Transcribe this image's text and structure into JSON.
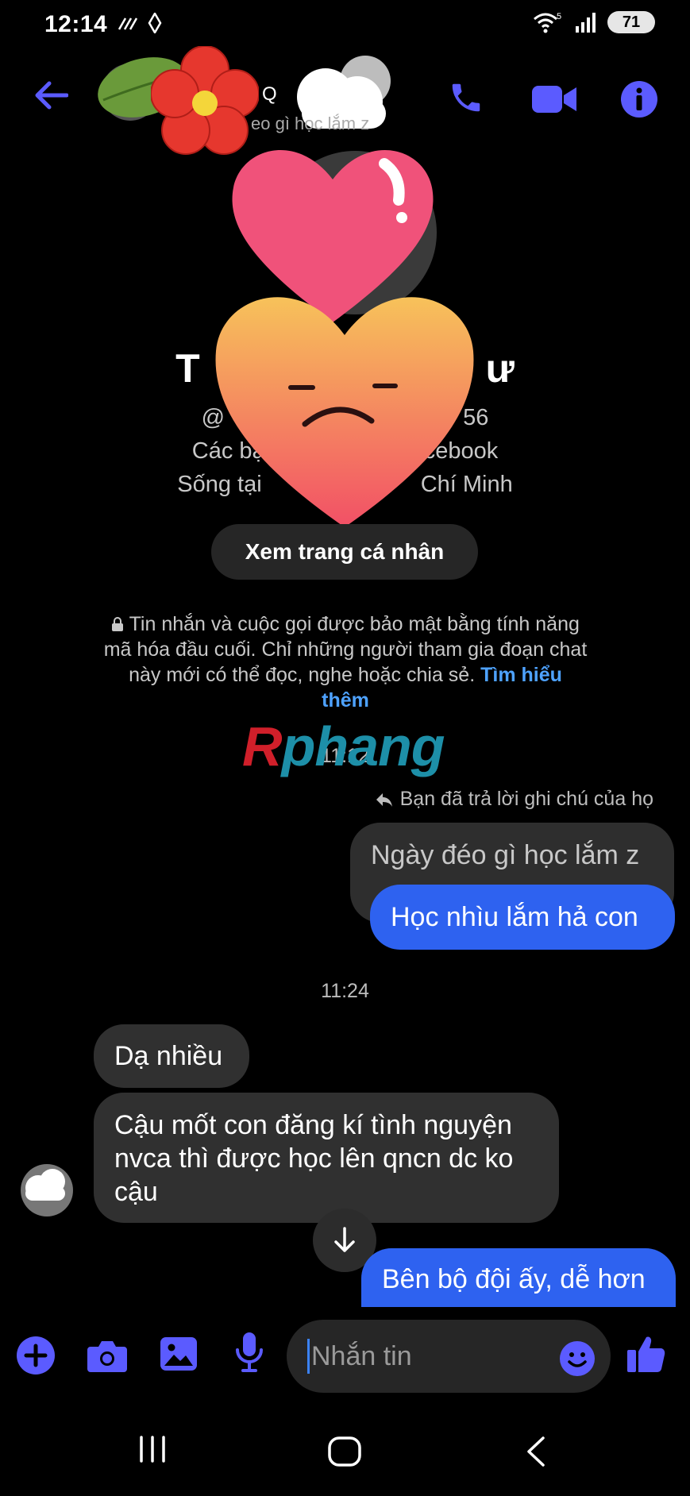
{
  "status_bar": {
    "time": "12:14",
    "battery": "71"
  },
  "header": {
    "contact_name": "Q",
    "subtitle": "eo gì học lắm z"
  },
  "profile": {
    "name_left": "T",
    "name_right": "ư",
    "handle_left": "@",
    "handle_right": "56",
    "line1_left": "Các bạ",
    "line1_right": "cebook",
    "line2_left": "Sống tại",
    "line2_right": "Chí Minh",
    "view_button": "Xem trang cá nhân"
  },
  "encryption": {
    "text": "Tin nhắn và cuộc gọi được bảo mật bằng tính năng mã hóa đầu cuối. Chỉ những người tham gia đoạn chat này mới có thể đọc, nghe hoặc chia sẻ.",
    "link": "Tìm hiểu thêm"
  },
  "watermark": "Rphang",
  "messages": {
    "time1": "11:12",
    "reply_note": "Bạn đã trả lời ghi chú của họ",
    "quoted_note": "Ngày đéo gì học lắm z",
    "out1": "Học nhìu lắm hả con",
    "time2": "11:24",
    "in1": "Dạ nhiều",
    "in2": "Cậu mốt con đăng kí tình nguyện nvca thì được học lên qncn dc ko cậu",
    "out2": "Bên bộ đội ấy, dễ hơn"
  },
  "composer": {
    "placeholder": "Nhắn tin"
  },
  "colors": {
    "accent": "#5b5bff",
    "outgoing_bubble": "#2e62f0",
    "incoming_bubble": "#303030",
    "link": "#4ea2ff"
  },
  "icons": [
    "back-arrow-icon",
    "phone-icon",
    "video-icon",
    "info-icon",
    "plus-icon",
    "camera-icon",
    "image-icon",
    "mic-icon",
    "emoji-icon",
    "thumbs-up-icon",
    "scroll-down-icon"
  ]
}
